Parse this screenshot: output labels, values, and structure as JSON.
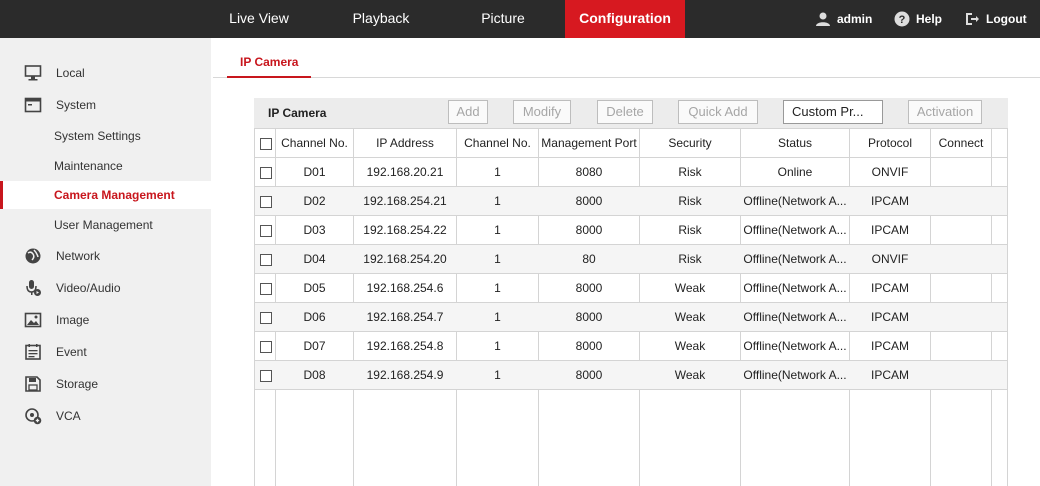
{
  "topnav": {
    "items": [
      "Live View",
      "Playback",
      "Picture",
      "Configuration"
    ],
    "active": "Configuration",
    "user": "admin",
    "help": "Help",
    "logout": "Logout"
  },
  "sidebar": {
    "local": "Local",
    "system": "System",
    "system_sub": [
      "System Settings",
      "Maintenance",
      "Camera Management",
      "User Management"
    ],
    "active_sub": "Camera Management",
    "network": "Network",
    "video_audio": "Video/Audio",
    "image": "Image",
    "event": "Event",
    "storage": "Storage",
    "vca": "VCA"
  },
  "tab": {
    "label": "IP Camera"
  },
  "panel": {
    "title": "IP Camera",
    "buttons": {
      "add": "Add",
      "modify": "Modify",
      "delete": "Delete",
      "quick_add": "Quick Add",
      "custom_protocol": "Custom Pr...",
      "activation": "Activation"
    }
  },
  "table": {
    "headers": [
      "Channel No.",
      "IP Address",
      "Channel No.",
      "Management Port",
      "Security",
      "Status",
      "Protocol",
      "Connect"
    ],
    "rows": [
      [
        "D01",
        "192.168.20.21",
        "1",
        "8080",
        "Risk",
        "Online",
        "ONVIF",
        ""
      ],
      [
        "D02",
        "192.168.254.21",
        "1",
        "8000",
        "Risk",
        "Offline(Network A...",
        "IPCAM",
        ""
      ],
      [
        "D03",
        "192.168.254.22",
        "1",
        "8000",
        "Risk",
        "Offline(Network A...",
        "IPCAM",
        ""
      ],
      [
        "D04",
        "192.168.254.20",
        "1",
        "80",
        "Risk",
        "Offline(Network A...",
        "ONVIF",
        ""
      ],
      [
        "D05",
        "192.168.254.6",
        "1",
        "8000",
        "Weak",
        "Offline(Network A...",
        "IPCAM",
        ""
      ],
      [
        "D06",
        "192.168.254.7",
        "1",
        "8000",
        "Weak",
        "Offline(Network A...",
        "IPCAM",
        ""
      ],
      [
        "D07",
        "192.168.254.8",
        "1",
        "8000",
        "Weak",
        "Offline(Network A...",
        "IPCAM",
        ""
      ],
      [
        "D08",
        "192.168.254.9",
        "1",
        "8000",
        "Weak",
        "Offline(Network A...",
        "IPCAM",
        ""
      ]
    ]
  },
  "colors": {
    "accent": "#d71920",
    "topbar": "#2b2b2b",
    "sidebar": "#f0f0f0"
  },
  "icons": [
    "user-icon",
    "help-icon",
    "logout-icon",
    "monitor-icon",
    "system-icon",
    "network-icon",
    "video-audio-icon",
    "image-icon",
    "event-icon",
    "storage-icon",
    "vca-icon"
  ]
}
